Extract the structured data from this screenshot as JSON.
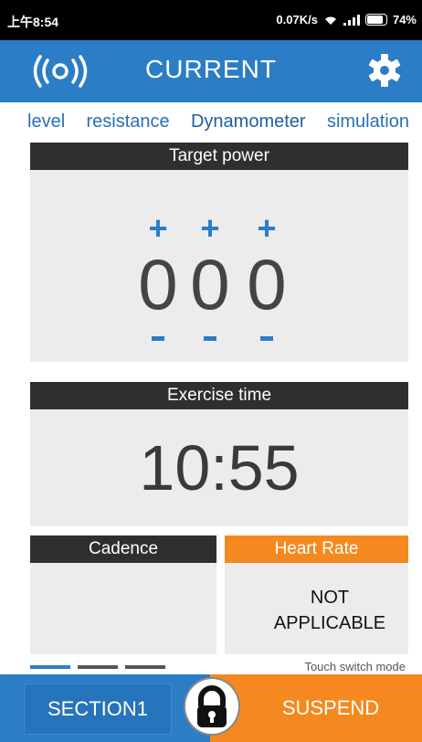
{
  "status_bar": {
    "time": "上午8:54",
    "network_speed": "0.07K/s",
    "battery": "74%",
    "icons": [
      "wifi-icon",
      "signal-icon",
      "battery-icon"
    ]
  },
  "app_bar": {
    "title": "CURRENT",
    "left_icon": "bluetooth-signal-icon",
    "right_icon": "gear-icon",
    "color": "#2b7dc6"
  },
  "tabs": [
    {
      "label": "level"
    },
    {
      "label": "resistance"
    },
    {
      "label": "Dynamometer"
    },
    {
      "label": "simulation"
    }
  ],
  "target_power": {
    "header": "Target power",
    "digits": [
      "0",
      "0",
      "0"
    ],
    "plus_symbol": "+"
  },
  "exercise_time": {
    "header": "Exercise time",
    "value": "10:55"
  },
  "cadence": {
    "header": "Cadence"
  },
  "heart_rate": {
    "header": "Heart Rate",
    "line1": "NOT",
    "line2": "APPLICABLE",
    "color": "#f5891f"
  },
  "footer": {
    "hint": "Touch switch mode",
    "page_count": 3,
    "active_page": 1,
    "section_label": "SECTION1",
    "suspend_label": "SUSPEND",
    "lock_icon": "lock-icon"
  }
}
